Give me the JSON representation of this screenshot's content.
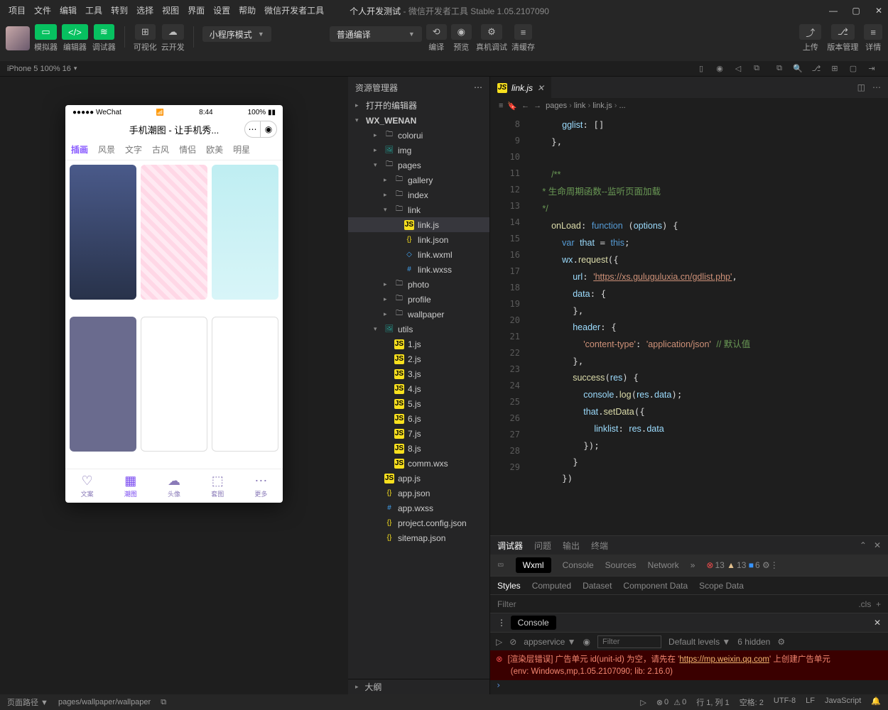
{
  "menubar": {
    "items": [
      "项目",
      "文件",
      "编辑",
      "工具",
      "转到",
      "选择",
      "视图",
      "界面",
      "设置",
      "帮助",
      "微信开发者工具"
    ],
    "project": "个人开发测试",
    "sub": "微信开发者工具 Stable 1.05.2107090"
  },
  "toolbar": {
    "sim": "模拟器",
    "edit": "编辑器",
    "dbg": "调试器",
    "vis": "可视化",
    "cloud": "云开发",
    "mode": "小程序模式",
    "compile": "普通编译",
    "c_compile": "编译",
    "c_preview": "预览",
    "c_remote": "真机调试",
    "c_cache": "清缓存",
    "r_upload": "上传",
    "r_version": "版本管理",
    "r_detail": "详情"
  },
  "devbar": {
    "device": "iPhone 5 100% 16"
  },
  "phone": {
    "carrier": "●●●●● WeChat",
    "time": "8:44",
    "battery": "100%",
    "title": "手机潮图 - 让手机秀...",
    "tabs": [
      "插画",
      "风景",
      "文字",
      "古风",
      "情侣",
      "欧美",
      "明星"
    ],
    "nav": [
      {
        "l": "文案",
        "i": "♡"
      },
      {
        "l": "潮图",
        "i": "▦"
      },
      {
        "l": "头像",
        "i": "☁"
      },
      {
        "l": "套图",
        "i": "⬚"
      },
      {
        "l": "更多",
        "i": "⋯"
      }
    ]
  },
  "explorer": {
    "title": "资源管理器",
    "open": "打开的编辑器",
    "root": "WX_WENAN",
    "nodes": [
      {
        "t": "folder",
        "n": "colorui",
        "d": 2
      },
      {
        "t": "img",
        "n": "img",
        "d": 2
      },
      {
        "t": "folder",
        "n": "pages",
        "d": 2,
        "open": true
      },
      {
        "t": "folder",
        "n": "gallery",
        "d": 3
      },
      {
        "t": "folder",
        "n": "index",
        "d": 3
      },
      {
        "t": "folder",
        "n": "link",
        "d": 3,
        "open": true
      },
      {
        "t": "js",
        "n": "link.js",
        "d": 4,
        "sel": true
      },
      {
        "t": "json",
        "n": "link.json",
        "d": 4
      },
      {
        "t": "wxml",
        "n": "link.wxml",
        "d": 4
      },
      {
        "t": "wxss",
        "n": "link.wxss",
        "d": 4
      },
      {
        "t": "folder",
        "n": "photo",
        "d": 3
      },
      {
        "t": "folder",
        "n": "profile",
        "d": 3
      },
      {
        "t": "folder",
        "n": "wallpaper",
        "d": 3
      },
      {
        "t": "img",
        "n": "utils",
        "d": 2,
        "open": true
      },
      {
        "t": "js",
        "n": "1.js",
        "d": 3
      },
      {
        "t": "js",
        "n": "2.js",
        "d": 3
      },
      {
        "t": "js",
        "n": "3.js",
        "d": 3
      },
      {
        "t": "js",
        "n": "4.js",
        "d": 3
      },
      {
        "t": "js",
        "n": "5.js",
        "d": 3
      },
      {
        "t": "js",
        "n": "6.js",
        "d": 3
      },
      {
        "t": "js",
        "n": "7.js",
        "d": 3
      },
      {
        "t": "js",
        "n": "8.js",
        "d": 3
      },
      {
        "t": "wxs",
        "n": "comm.wxs",
        "d": 3
      },
      {
        "t": "js",
        "n": "app.js",
        "d": 2
      },
      {
        "t": "json",
        "n": "app.json",
        "d": 2
      },
      {
        "t": "wxss",
        "n": "app.wxss",
        "d": 2
      },
      {
        "t": "json",
        "n": "project.config.json",
        "d": 2
      },
      {
        "t": "json",
        "n": "sitemap.json",
        "d": 2
      }
    ],
    "outline": "大纲"
  },
  "editor": {
    "tab": "link.js",
    "bread": [
      "pages",
      "link",
      "link.js",
      "..."
    ],
    "lines": [
      {
        "n": 8,
        "h": "      <span class='c-prop'>gglist</span>: []"
      },
      {
        "n": 9,
        "h": "    },"
      },
      {
        "n": 10,
        "h": ""
      },
      {
        "n": 11,
        "h": "    <span class='c-cm'>/**</span>"
      },
      {
        "n": 12,
        "h": "<span class='c-cm'>     * 生命周期函数--监听页面加载</span>"
      },
      {
        "n": 13,
        "h": "<span class='c-cm'>     */</span>"
      },
      {
        "n": 14,
        "h": "    <span class='c-fn'>onLoad</span>: <span class='c-kw'>function</span> (<span class='c-prm'>options</span>) {"
      },
      {
        "n": 15,
        "h": "      <span class='c-kw'>var</span> <span class='c-var'>that</span> = <span class='c-kw'>this</span>;"
      },
      {
        "n": 16,
        "h": "      <span class='c-var'>wx</span>.<span class='c-fn'>request</span>({"
      },
      {
        "n": 17,
        "h": "        <span class='c-prop'>url</span>: <span class='c-str u'>'https://xs.guluguluxia.cn/gdlist.php'</span>,"
      },
      {
        "n": 18,
        "h": "        <span class='c-prop'>data</span>: {"
      },
      {
        "n": 19,
        "h": "        },"
      },
      {
        "n": 20,
        "h": "        <span class='c-prop'>header</span>: {"
      },
      {
        "n": 21,
        "h": "          <span class='c-str'>'content-type'</span>: <span class='c-str'>'application/json'</span> <span class='c-cm'>// 默认值</span>"
      },
      {
        "n": 22,
        "h": "        },"
      },
      {
        "n": 23,
        "h": "        <span class='c-fn'>success</span>(<span class='c-prm'>res</span>) {"
      },
      {
        "n": 24,
        "h": "          <span class='c-var'>console</span>.<span class='c-fn'>log</span>(<span class='c-var'>res</span>.<span class='c-prop'>data</span>);"
      },
      {
        "n": 25,
        "h": "          <span class='c-var'>that</span>.<span class='c-fn'>setData</span>({"
      },
      {
        "n": 26,
        "h": "            <span class='c-prop'>linklist</span>: <span class='c-var'>res</span>.<span class='c-prop'>data</span>"
      },
      {
        "n": 27,
        "h": "          });"
      },
      {
        "n": 28,
        "h": "        }"
      },
      {
        "n": 29,
        "h": "      })"
      }
    ]
  },
  "devtools": {
    "tabs": [
      "调试器",
      "问题",
      "输出",
      "终端"
    ],
    "sub": [
      "Wxml",
      "Console",
      "Sources",
      "Network"
    ],
    "errs": "13",
    "warns": "13",
    "info": "6",
    "styles": [
      "Styles",
      "Computed",
      "Dataset",
      "Component Data",
      "Scope Data"
    ],
    "filter": "Filter",
    "cls": ".cls",
    "console": "Console",
    "ctx": "appservice",
    "levels": "Default levels",
    "hidden": "6 hidden",
    "err1": "[渲染层错误] 广告单元 id(unit-id) 为空，请先在 '",
    "errurl": "https://mp.weixin.qq.com",
    "err1b": "' 上创建广告单元",
    "err2": "(env: Windows,mp,1.05.2107090; lib: 2.16.0)"
  },
  "status": {
    "path_lbl": "页面路径",
    "path": "pages/wallpaper/wallpaper",
    "errs": "0",
    "warns": "0",
    "pos": "行 1, 列 1",
    "spaces": "空格: 2",
    "enc": "UTF-8",
    "eol": "LF",
    "lang": "JavaScript"
  }
}
